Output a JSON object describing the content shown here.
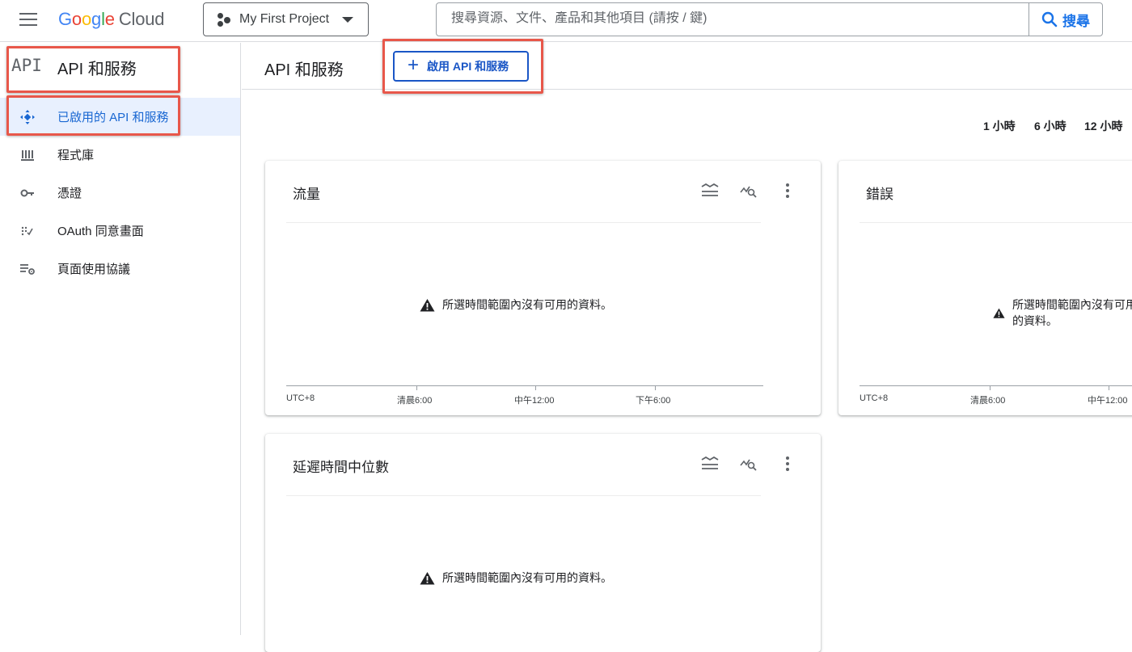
{
  "topbar": {
    "logo_letters": [
      "G",
      "o",
      "o",
      "g",
      "l",
      "e"
    ],
    "logo_cloud": "Cloud",
    "project_name": "My First Project",
    "search_placeholder": "搜尋資源、文件、產品和其他項目 (請按 / 鍵)",
    "search_button": "搜尋"
  },
  "sidebar": {
    "mono_label": "API",
    "title": "API 和服務",
    "items": [
      {
        "label": "已啟用的 API 和服務",
        "icon": "api-diamond-icon",
        "active": true
      },
      {
        "label": "程式庫",
        "icon": "library-icon",
        "active": false
      },
      {
        "label": "憑證",
        "icon": "key-icon",
        "active": false
      },
      {
        "label": "OAuth 同意畫面",
        "icon": "oauth-icon",
        "active": false
      },
      {
        "label": "頁面使用協議",
        "icon": "page-settings-icon",
        "active": false
      }
    ]
  },
  "main": {
    "title": "API 和服務",
    "enable_button": "啟用 API 和服務",
    "time_ranges": [
      "1 小時",
      "6 小時",
      "12 小時"
    ],
    "cards": [
      {
        "title": "流量",
        "no_data": "所選時間範圍內沒有可用的資料。",
        "x_labels": [
          "UTC+8",
          "清晨6:00",
          "中午12:00",
          "下午6:00"
        ]
      },
      {
        "title": "錯誤",
        "no_data": "所選時間範圍內沒有可用的資料。",
        "x_labels": [
          "UTC+8",
          "清晨6:00",
          "中午12:00"
        ]
      },
      {
        "title": "延遲時間中位數",
        "no_data": "所選時間範圍內沒有可用的資料。"
      }
    ]
  },
  "colors": {
    "accent_blue": "#1a73e8",
    "highlight_red": "#e8574a",
    "active_bg": "#e8f0fe"
  }
}
